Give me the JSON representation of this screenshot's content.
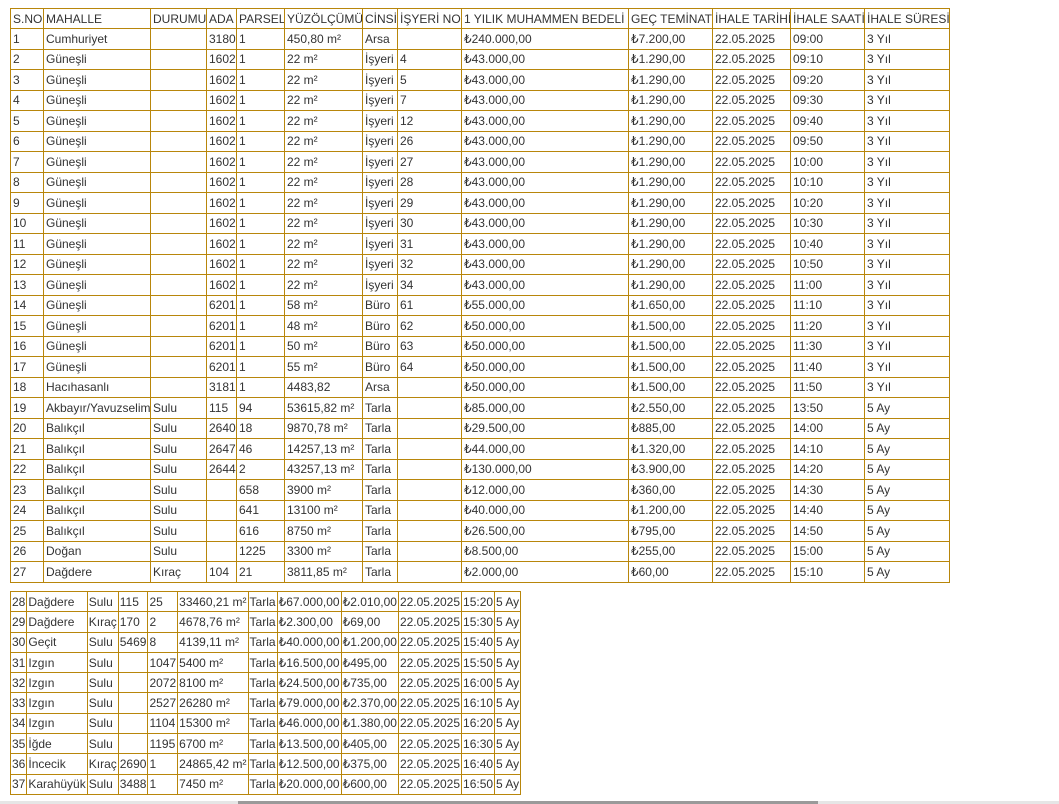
{
  "table1": {
    "headers": [
      "S.NO",
      "MAHALLE",
      "DURUMU",
      "ADA",
      "PARSEL",
      "YÜZÖLÇÜMÜ",
      "CİNSİ",
      "İŞYERİ NO",
      "1 YILIK MUHAMMEN BEDELİ",
      "GEÇ TEMİNAT",
      "İHALE TARİHİ",
      "İHALE SAATİ",
      "İHALE SÜRESİ"
    ],
    "rows": [
      [
        "1",
        "Cumhuriyet",
        "",
        "3180",
        "1",
        "450,80 m²",
        "Arsa",
        "",
        "₺240.000,00",
        "₺7.200,00",
        "22.05.2025",
        "09:00",
        "3 Yıl"
      ],
      [
        "2",
        "Güneşli",
        "",
        "1602",
        "1",
        "22 m²",
        "İşyeri",
        "4",
        "₺43.000,00",
        "₺1.290,00",
        "22.05.2025",
        "09:10",
        "3 Yıl"
      ],
      [
        "3",
        "Güneşli",
        "",
        "1602",
        "1",
        "22 m²",
        "İşyeri",
        "5",
        "₺43.000,00",
        "₺1.290,00",
        "22.05.2025",
        "09:20",
        "3 Yıl"
      ],
      [
        "4",
        "Güneşli",
        "",
        "1602",
        "1",
        "22 m²",
        "İşyeri",
        "7",
        "₺43.000,00",
        "₺1.290,00",
        "22.05.2025",
        "09:30",
        "3 Yıl"
      ],
      [
        "5",
        "Güneşli",
        "",
        "1602",
        "1",
        "22 m²",
        "İşyeri",
        "12",
        "₺43.000,00",
        "₺1.290,00",
        "22.05.2025",
        "09:40",
        "3 Yıl"
      ],
      [
        "6",
        "Güneşli",
        "",
        "1602",
        "1",
        "22 m²",
        "İşyeri",
        "26",
        "₺43.000,00",
        "₺1.290,00",
        "22.05.2025",
        "09:50",
        "3 Yıl"
      ],
      [
        "7",
        "Güneşli",
        "",
        "1602",
        "1",
        "22 m²",
        "İşyeri",
        "27",
        "₺43.000,00",
        "₺1.290,00",
        "22.05.2025",
        "10:00",
        "3 Yıl"
      ],
      [
        "8",
        "Güneşli",
        "",
        "1602",
        "1",
        "22 m²",
        "İşyeri",
        "28",
        "₺43.000,00",
        "₺1.290,00",
        "22.05.2025",
        "10:10",
        "3 Yıl"
      ],
      [
        "9",
        "Güneşli",
        "",
        "1602",
        "1",
        "22 m²",
        "İşyeri",
        "29",
        "₺43.000,00",
        "₺1.290,00",
        "22.05.2025",
        "10:20",
        "3 Yıl"
      ],
      [
        "10",
        "Güneşli",
        "",
        "1602",
        "1",
        "22 m²",
        "İşyeri",
        "30",
        "₺43.000,00",
        "₺1.290,00",
        "22.05.2025",
        "10:30",
        "3 Yıl"
      ],
      [
        "11",
        "Güneşli",
        "",
        "1602",
        "1",
        "22 m²",
        "İşyeri",
        "31",
        "₺43.000,00",
        "₺1.290,00",
        "22.05.2025",
        "10:40",
        "3 Yıl"
      ],
      [
        "12",
        "Güneşli",
        "",
        "1602",
        "1",
        "22 m²",
        "İşyeri",
        "32",
        "₺43.000,00",
        "₺1.290,00",
        "22.05.2025",
        "10:50",
        "3 Yıl"
      ],
      [
        "13",
        "Güneşli",
        "",
        "1602",
        "1",
        "22 m²",
        "İşyeri",
        "34",
        "₺43.000,00",
        "₺1.290,00",
        "22.05.2025",
        "11:00",
        "3 Yıl"
      ],
      [
        "14",
        "Güneşli",
        "",
        "6201",
        "1",
        "58 m²",
        "Büro",
        "61",
        "₺55.000,00",
        "₺1.650,00",
        "22.05.2025",
        "11:10",
        "3 Yıl"
      ],
      [
        "15",
        "Güneşli",
        "",
        "6201",
        "1",
        "48 m²",
        "Büro",
        "62",
        "₺50.000,00",
        "₺1.500,00",
        "22.05.2025",
        "11:20",
        "3 Yıl"
      ],
      [
        "16",
        "Güneşli",
        "",
        "6201",
        "1",
        "50 m²",
        "Büro",
        "63",
        "₺50.000,00",
        "₺1.500,00",
        "22.05.2025",
        "11:30",
        "3 Yıl"
      ],
      [
        "17",
        "Güneşli",
        "",
        "6201",
        "1",
        "55 m²",
        "Büro",
        "64",
        "₺50.000,00",
        "₺1.500,00",
        "22.05.2025",
        "11:40",
        "3 Yıl"
      ],
      [
        "18",
        "Hacıhasanlı",
        "",
        "3181",
        "1",
        "4483,82",
        "Arsa",
        "",
        "₺50.000,00",
        "₺1.500,00",
        "22.05.2025",
        "11:50",
        "3 Yıl"
      ],
      [
        "19",
        "Akbayır/Yavuzselim",
        "Sulu",
        "115",
        "94",
        "53615,82 m²",
        "Tarla",
        "",
        "₺85.000,00",
        "₺2.550,00",
        "22.05.2025",
        "13:50",
        "5 Ay"
      ],
      [
        "20",
        "Balıkçıl",
        "Sulu",
        "2640",
        "18",
        "9870,78 m²",
        "Tarla",
        "",
        "₺29.500,00",
        "₺885,00",
        "22.05.2025",
        "14:00",
        "5 Ay"
      ],
      [
        "21",
        "Balıkçıl",
        "Sulu",
        "2647",
        "46",
        "14257,13 m²",
        "Tarla",
        "",
        "₺44.000,00",
        "₺1.320,00",
        "22.05.2025",
        "14:10",
        "5 Ay"
      ],
      [
        "22",
        "Balıkçıl",
        "Sulu",
        "2644",
        "2",
        "43257,13 m²",
        "Tarla",
        "",
        "₺130.000,00",
        "₺3.900,00",
        "22.05.2025",
        "14:20",
        "5 Ay"
      ],
      [
        "23",
        "Balıkçıl",
        "Sulu",
        "",
        "658",
        "3900 m²",
        "Tarla",
        "",
        "₺12.000,00",
        "₺360,00",
        "22.05.2025",
        "14:30",
        "5 Ay"
      ],
      [
        "24",
        "Balıkçıl",
        "Sulu",
        "",
        "641",
        "13100 m²",
        "Tarla",
        "",
        "₺40.000,00",
        "₺1.200,00",
        "22.05.2025",
        "14:40",
        "5 Ay"
      ],
      [
        "25",
        "Balıkçıl",
        "Sulu",
        "",
        "616",
        "8750 m²",
        "Tarla",
        "",
        "₺26.500,00",
        "₺795,00",
        "22.05.2025",
        "14:50",
        "5 Ay"
      ],
      [
        "26",
        "Doğan",
        "Sulu",
        "",
        "1225",
        "3300 m²",
        "Tarla",
        "",
        "₺8.500,00",
        "₺255,00",
        "22.05.2025",
        "15:00",
        "5 Ay"
      ],
      [
        "27",
        "Dağdere",
        "Kıraç",
        "104",
        "21",
        "3811,85 m²",
        "Tarla",
        "",
        "₺2.000,00",
        "₺60,00",
        "22.05.2025",
        "15:10",
        "5 Ay"
      ]
    ]
  },
  "table2": {
    "rows": [
      [
        "28",
        "Dağdere",
        "Sulu",
        "115",
        "25",
        "33460,21 m²",
        "Tarla",
        "₺67.000,00",
        "₺2.010,00",
        "22.05.2025",
        "15:20",
        "5 Ay"
      ],
      [
        "29",
        "Dağdere",
        "Kıraç",
        "170",
        "2",
        "4678,76 m²",
        "Tarla",
        "₺2.300,00",
        "₺69,00",
        "22.05.2025",
        "15:30",
        "5 Ay"
      ],
      [
        "30",
        "Geçit",
        "Sulu",
        "5469",
        "8",
        "4139,11 m²",
        "Tarla",
        "₺40.000,00",
        "₺1.200,00",
        "22.05.2025",
        "15:40",
        "5 Ay"
      ],
      [
        "31",
        "Izgın",
        "Sulu",
        "",
        "1047",
        "5400 m²",
        "Tarla",
        "₺16.500,00",
        "₺495,00",
        "22.05.2025",
        "15:50",
        "5 Ay"
      ],
      [
        "32",
        "Izgın",
        "Sulu",
        "",
        "2072",
        "8100 m²",
        "Tarla",
        "₺24.500,00",
        "₺735,00",
        "22.05.2025",
        "16:00",
        "5 Ay"
      ],
      [
        "33",
        "Izgın",
        "Sulu",
        "",
        "2527",
        "26280 m²",
        "Tarla",
        "₺79.000,00",
        "₺2.370,00",
        "22.05.2025",
        "16:10",
        "5 Ay"
      ],
      [
        "34",
        "Izgın",
        "Sulu",
        "",
        "1104",
        "15300 m²",
        "Tarla",
        "₺46.000,00",
        "₺1.380,00",
        "22.05.2025",
        "16:20",
        "5 Ay"
      ],
      [
        "35",
        "İğde",
        "Sulu",
        "",
        "1195",
        "6700 m²",
        "Tarla",
        "₺13.500,00",
        "₺405,00",
        "22.05.2025",
        "16:30",
        "5 Ay"
      ],
      [
        "36",
        "İncecik",
        "Kıraç",
        "2690",
        "1",
        "24865,42 m²",
        "Tarla",
        "₺12.500,00",
        "₺375,00",
        "22.05.2025",
        "16:40",
        "5 Ay"
      ],
      [
        "37",
        "Karahüyük",
        "Sulu",
        "3488",
        "1",
        "7450 m²",
        "Tarla",
        "₺20.000,00",
        "₺600,00",
        "22.05.2025",
        "16:50",
        "5 Ay"
      ]
    ]
  },
  "colors": {
    "border": "#b8860b",
    "text": "#333333"
  }
}
